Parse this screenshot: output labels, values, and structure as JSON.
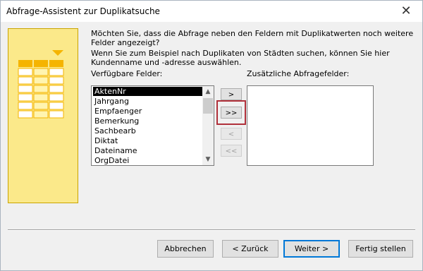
{
  "window": {
    "title": "Abfrage-Assistent zur Duplikatsuche",
    "close_glyph": "✕"
  },
  "prompt": "Möchten Sie, dass die Abfrage neben den Feldern mit Duplikatwerten noch weitere Felder angezeigt?",
  "example": "Wenn Sie zum Beispiel nach Duplikaten von Städten suchen, können Sie hier Kundenname und -adresse auswählen.",
  "available": {
    "label": "Verfügbare Felder:",
    "items": [
      "AktenNr",
      "Jahrgang",
      "Empfaenger",
      "Bemerkung",
      "Sachbearb",
      "Diktat",
      "Dateiname",
      "OrgDatei"
    ],
    "selected": "AktenNr"
  },
  "additional": {
    "label": "Zusätzliche Abfragefelder:",
    "items": []
  },
  "move_buttons": {
    "add_one": ">",
    "add_all": ">>",
    "remove_one": "<",
    "remove_all": "<<"
  },
  "buttons": {
    "cancel": "Abbrechen",
    "back": "< Zurück",
    "next": "Weiter >",
    "finish": "Fertig stellen"
  },
  "colors": {
    "art_fill": "#fbe98a",
    "art_grid": "#f5b400",
    "highlight": "#b0303a",
    "focus": "#0078d7"
  }
}
